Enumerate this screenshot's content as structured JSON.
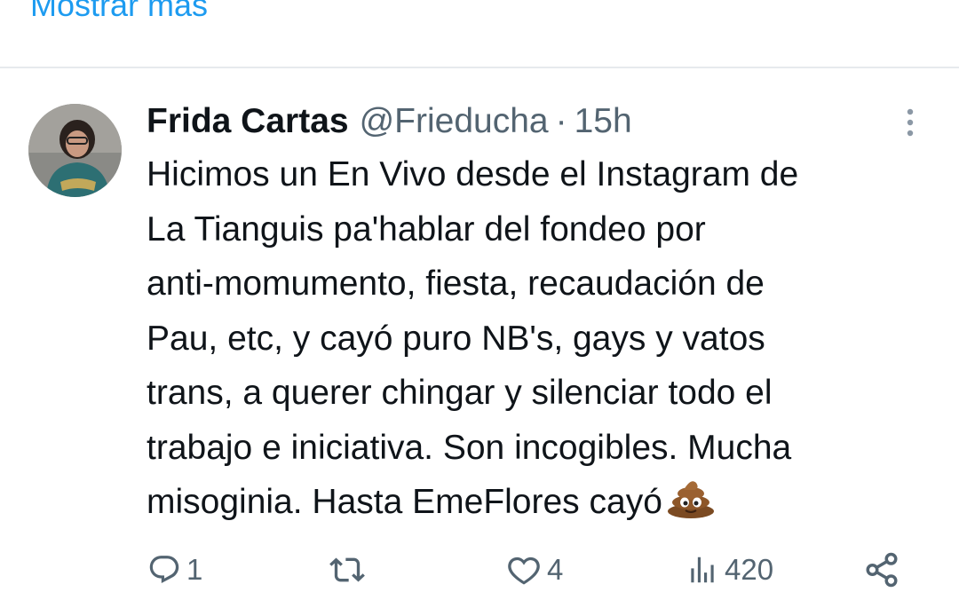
{
  "show_more": "Mostrar más",
  "tweet": {
    "author_name": "Frida Cartas",
    "handle": "@Frieducha",
    "separator": "·",
    "time": "15h",
    "text_lines": [
      "Hicimos un En Vivo desde el Instagram de",
      "La Tianguis pa'hablar del fondeo por",
      "anti-momumento, fiesta, recaudación de",
      "Pau, etc, y cayó puro NB's, gays y vatos",
      "trans, a querer chingar y silenciar todo el",
      "trabajo e iniciativa. Son incogibles. Mucha",
      "misoginia. Hasta EmeFlores cayó"
    ],
    "emoji": "poop-emoji"
  },
  "actions": {
    "reply_count": "1",
    "retweet_count": "",
    "like_count": "4",
    "views_count": "420"
  },
  "icons": [
    "more-icon",
    "reply-icon",
    "retweet-icon",
    "like-icon",
    "views-icon",
    "share-icon"
  ],
  "colors": {
    "accent": "#1d9bf0",
    "text": "#0f1419",
    "secondary": "#536471",
    "divider": "#e6eaed"
  }
}
